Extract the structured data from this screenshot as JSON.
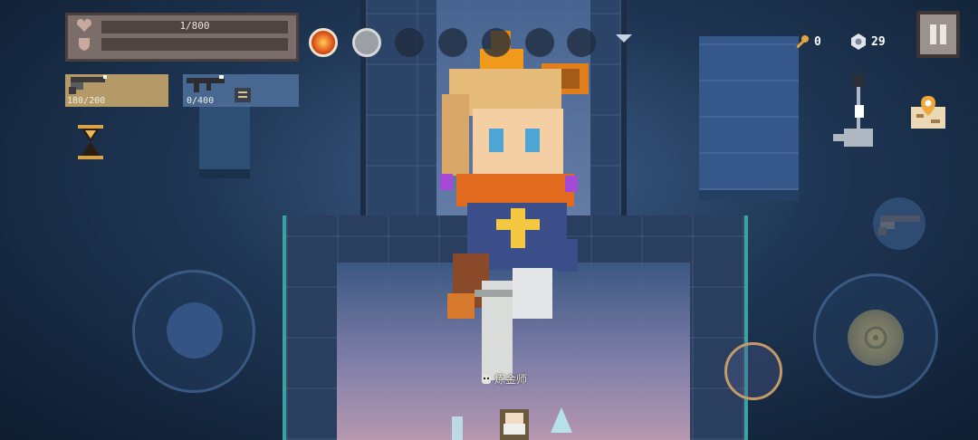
{
  "hud": {
    "hp_text": "1/800",
    "weapons": [
      {
        "icon": "revolver-icon",
        "ammo": "180/200"
      },
      {
        "icon": "rifle-icon",
        "ammo": "0/400"
      }
    ],
    "buffs": [
      "fire-buff-icon",
      "gray-buff-icon",
      "empty",
      "empty",
      "empty",
      "empty",
      "empty"
    ],
    "keys": "0",
    "gems": "29"
  },
  "npc": {
    "name": "炼金师"
  },
  "colors": {
    "hp_panel": "#7a6d6a",
    "weapon_active": "#b49a67",
    "weapon_inactive": "#4c6e98",
    "wall_trim": "#3aa3a0",
    "key": "#e6a53a"
  }
}
